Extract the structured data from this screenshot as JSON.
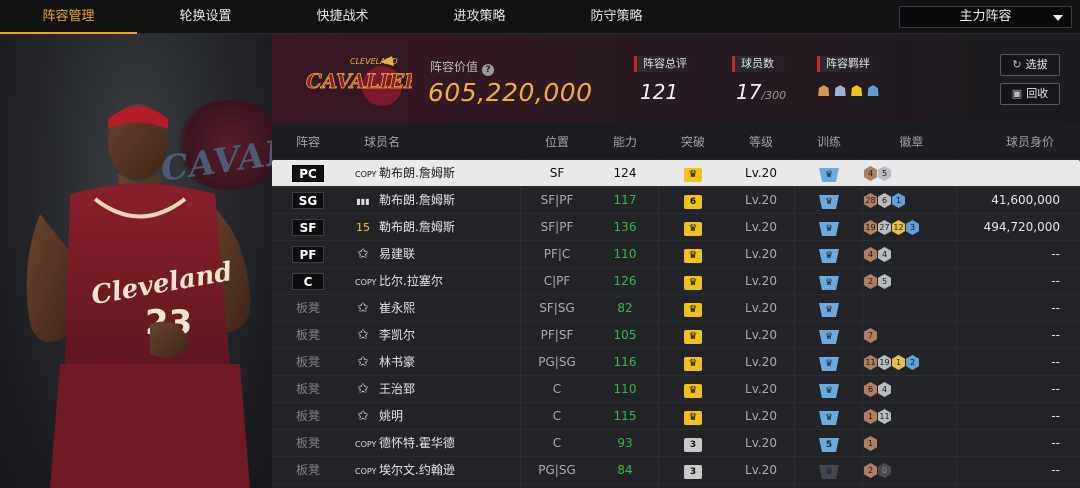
{
  "nav": {
    "tabs": [
      {
        "label": "阵容管理",
        "active": true
      },
      {
        "label": "轮换设置",
        "active": false
      },
      {
        "label": "快捷战术",
        "active": false
      },
      {
        "label": "进攻策略",
        "active": false
      },
      {
        "label": "防守策略",
        "active": false
      }
    ],
    "lineup_select": "主力阵容"
  },
  "header": {
    "team_logo_text": "CAVALIERS",
    "team_logo_sub": "CLEVELAND",
    "lineup_value_label": "阵容价值",
    "lineup_value": "605,220,000",
    "rating_label": "阵容总评",
    "rating_value": "121",
    "players_label": "球员数",
    "players_value": "17",
    "players_max": "/300",
    "bond_label": "阵容羁绊",
    "select_btn": "选拔",
    "recycle_btn": "回收"
  },
  "table": {
    "headers": {
      "slot": "阵容",
      "name": "球员名",
      "pos": "位置",
      "ability": "能力",
      "breakthrough": "突破",
      "level": "等级",
      "training": "训练",
      "badges": "徽章",
      "value": "球员身价"
    },
    "rows": [
      {
        "slot": "PC",
        "starter": true,
        "icon": "COPY",
        "name": "勒布朗.詹姆斯",
        "pos": "SF",
        "ability": "124",
        "brk": "",
        "brk_color": "gold",
        "level": "Lv.20",
        "trn": "",
        "badges": [
          {
            "t": "4",
            "c": "br"
          },
          {
            "t": "5",
            "c": "si"
          }
        ],
        "value": "--"
      },
      {
        "slot": "SG",
        "starter": true,
        "icon": "bars",
        "name": "勒布朗.詹姆斯",
        "pos": "SF|PF",
        "ability": "117",
        "brk": "6",
        "brk_color": "gold",
        "level": "Lv.20",
        "trn": "",
        "badges": [
          {
            "t": "28",
            "c": "br"
          },
          {
            "t": "6",
            "c": "si"
          },
          {
            "t": "1",
            "c": "bl"
          }
        ],
        "value": "41,600,000"
      },
      {
        "slot": "SF",
        "starter": true,
        "icon": "15",
        "name": "勒布朗.詹姆斯",
        "pos": "SF|PF",
        "ability": "136",
        "brk": "",
        "brk_color": "gold",
        "level": "Lv.20",
        "trn": "",
        "badges": [
          {
            "t": "19",
            "c": "br"
          },
          {
            "t": "27",
            "c": "si"
          },
          {
            "t": "12",
            "c": "go"
          },
          {
            "t": "3",
            "c": "bl"
          }
        ],
        "value": "494,720,000"
      },
      {
        "slot": "PF",
        "starter": true,
        "icon": "star",
        "name": "易建联",
        "pos": "PF|C",
        "ability": "110",
        "brk": "",
        "brk_color": "gold",
        "level": "Lv.20",
        "trn": "",
        "badges": [
          {
            "t": "4",
            "c": "br"
          },
          {
            "t": "4",
            "c": "si"
          }
        ],
        "value": "--"
      },
      {
        "slot": "C",
        "starter": true,
        "icon": "COPY",
        "name": "比尔.拉塞尔",
        "pos": "C|PF",
        "ability": "126",
        "brk": "",
        "brk_color": "gold",
        "level": "Lv.20",
        "trn": "",
        "badges": [
          {
            "t": "2",
            "c": "br"
          },
          {
            "t": "5",
            "c": "si"
          }
        ],
        "value": "--"
      },
      {
        "slot": "板凳",
        "starter": false,
        "icon": "star",
        "name": "崔永熙",
        "pos": "SF|SG",
        "ability": "82",
        "brk": "",
        "brk_color": "gold",
        "level": "Lv.20",
        "trn": "",
        "badges": [],
        "value": "--"
      },
      {
        "slot": "板凳",
        "starter": false,
        "icon": "star",
        "name": "李凯尔",
        "pos": "PF|SF",
        "ability": "105",
        "brk": "",
        "brk_color": "gold",
        "level": "Lv.20",
        "trn": "",
        "badges": [
          {
            "t": "7",
            "c": "br"
          }
        ],
        "value": "--"
      },
      {
        "slot": "板凳",
        "starter": false,
        "icon": "star",
        "name": "林书豪",
        "pos": "PG|SG",
        "ability": "116",
        "brk": "",
        "brk_color": "gold",
        "level": "Lv.20",
        "trn": "",
        "badges": [
          {
            "t": "11",
            "c": "br"
          },
          {
            "t": "19",
            "c": "si"
          },
          {
            "t": "1",
            "c": "go"
          },
          {
            "t": "2",
            "c": "bl"
          }
        ],
        "value": "--"
      },
      {
        "slot": "板凳",
        "starter": false,
        "icon": "star",
        "name": "王治郅",
        "pos": "C",
        "ability": "110",
        "brk": "",
        "brk_color": "gold",
        "level": "Lv.20",
        "trn": "",
        "badges": [
          {
            "t": "6",
            "c": "br"
          },
          {
            "t": "4",
            "c": "si"
          }
        ],
        "value": "--"
      },
      {
        "slot": "板凳",
        "starter": false,
        "icon": "star",
        "name": "姚明",
        "pos": "C",
        "ability": "115",
        "brk": "",
        "brk_color": "gold",
        "level": "Lv.20",
        "trn": "",
        "badges": [
          {
            "t": "1",
            "c": "br"
          },
          {
            "t": "11",
            "c": "si"
          }
        ],
        "value": "--"
      },
      {
        "slot": "板凳",
        "starter": false,
        "icon": "COPY",
        "name": "德怀特.霍华德",
        "pos": "C",
        "ability": "93",
        "brk": "3",
        "brk_color": "grey",
        "level": "Lv.20",
        "trn": "5",
        "badges": [
          {
            "t": "1",
            "c": "br"
          }
        ],
        "value": "--"
      },
      {
        "slot": "板凳",
        "starter": false,
        "icon": "COPY",
        "name": "埃尔文.约翰逊",
        "pos": "PG|SG",
        "ability": "84",
        "brk": "3",
        "brk_color": "grey",
        "level": "Lv.20",
        "trn": "",
        "trn_dark": true,
        "badges": [
          {
            "t": "2",
            "c": "br"
          },
          {
            "t": "0",
            "c": "dk"
          }
        ],
        "value": "--"
      }
    ]
  }
}
